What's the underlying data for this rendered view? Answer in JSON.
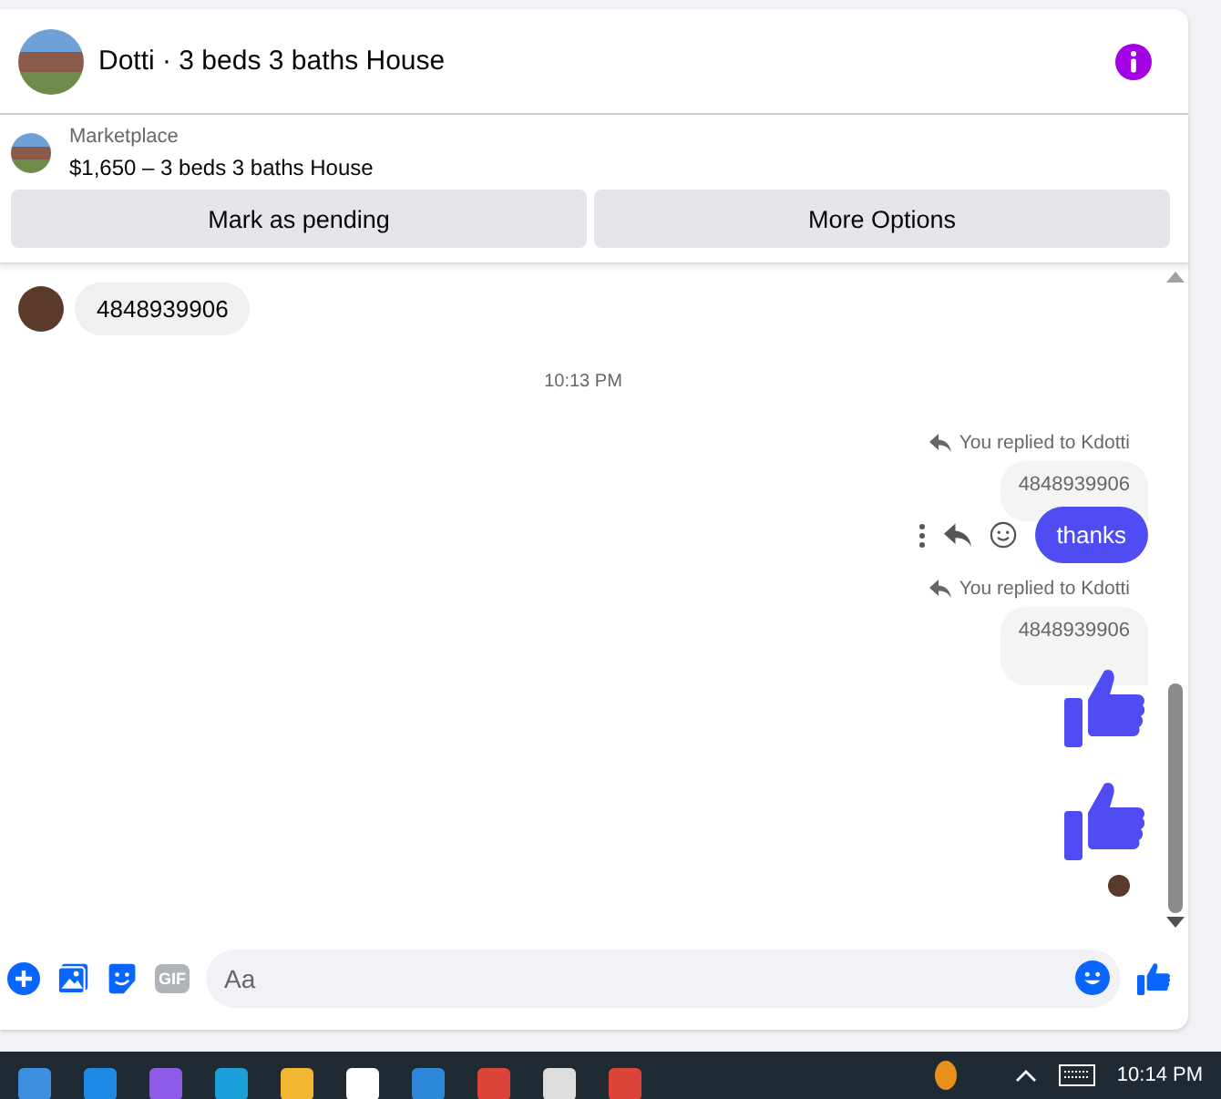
{
  "header": {
    "title": "Dotti · 3 beds 3 baths House"
  },
  "listing": {
    "source": "Marketplace",
    "title": "$1,650 – 3 beds 3 baths House"
  },
  "buttons": [
    "Mark as pending",
    "More Options"
  ],
  "messages": [
    {
      "kind": "incoming",
      "text": "4848939906"
    },
    {
      "kind": "timestamp",
      "text": "10:13 PM"
    },
    {
      "kind": "reply-text",
      "note": "You replied to Kdotti",
      "quote": "4848939906",
      "text": "thanks",
      "show_actions": true
    },
    {
      "kind": "reply-like",
      "note": "You replied to Kdotti",
      "quote": "4848939906"
    },
    {
      "kind": "like",
      "seen": true
    }
  ],
  "composer": {
    "placeholder": "Aa",
    "gif_label": "GIF"
  },
  "taskbar": {
    "time": "10:14 PM"
  }
}
